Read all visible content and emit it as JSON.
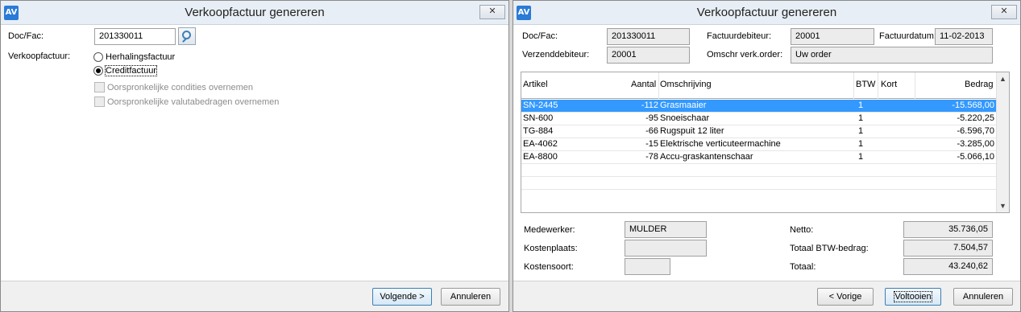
{
  "w1": {
    "title": "Verkoopfactuur genereren",
    "app_icon": "AV",
    "close": "✕",
    "doc_label": "Doc/Fac:",
    "doc_value": "201330011",
    "type_label": "Verkoopfactuur:",
    "opt_herhaling": "Herhalingsfactuur",
    "opt_credit": "Creditfactuur",
    "chk_condities": "Oorspronkelijke condities overnemen",
    "chk_valuta": "Oorspronkelijke valutabedragen overnemen",
    "btn_next": "Volgende >",
    "btn_cancel": "Annuleren"
  },
  "w2": {
    "title": "Verkoopfactuur genereren",
    "app_icon": "AV",
    "close": "✕",
    "doc_label": "Doc/Fac:",
    "doc_value": "201330011",
    "ship_label": "Verzenddebiteur:",
    "ship_value": "20001",
    "inv_debtor_label": "Factuurdebiteur:",
    "inv_debtor_value": "20001",
    "date_label": "Factuurdatum:",
    "date_value": "11-02-2013",
    "order_label": "Omschr verk.order:",
    "order_value": "Uw order",
    "columns": {
      "artikel": "Artikel",
      "aantal": "Aantal",
      "omschrijving": "Omschrijving",
      "btw": "BTW",
      "kort": "Kort",
      "bedrag": "Bedrag"
    },
    "rows": [
      {
        "artikel": "SN-2445",
        "aantal": "-112",
        "omschrijving": "Grasmaaier",
        "btw": "1",
        "bedrag": "-15.568,00"
      },
      {
        "artikel": "SN-600",
        "aantal": "-95",
        "omschrijving": "Snoeischaar",
        "btw": "1",
        "bedrag": "-5.220,25"
      },
      {
        "artikel": "TG-884",
        "aantal": "-66",
        "omschrijving": "Rugspuit 12 liter",
        "btw": "1",
        "bedrag": "-6.596,70"
      },
      {
        "artikel": "EA-4062",
        "aantal": "-15",
        "omschrijving": "Elektrische verticuteermachine",
        "btw": "1",
        "bedrag": "-3.285,00"
      },
      {
        "artikel": "EA-8800",
        "aantal": "-78",
        "omschrijving": "Accu-graskantenschaar",
        "btw": "1",
        "bedrag": "-5.066,10"
      }
    ],
    "medewerker_label": "Medewerker:",
    "medewerker_value": "MULDER",
    "kostenplaats_label": "Kostenplaats:",
    "kostenplaats_value": "",
    "kostensoort_label": "Kostensoort:",
    "kostensoort_value": "",
    "netto_label": "Netto:",
    "netto_value": "35.736,05",
    "btw_label": "Totaal BTW-bedrag:",
    "btw_value": "7.504,57",
    "totaal_label": "Totaal:",
    "totaal_value": "43.240,62",
    "btn_prev": "< Vorige",
    "btn_finish": "Voltooien",
    "btn_cancel": "Annuleren",
    "scroll_up": "▲",
    "scroll_down": "▼"
  }
}
